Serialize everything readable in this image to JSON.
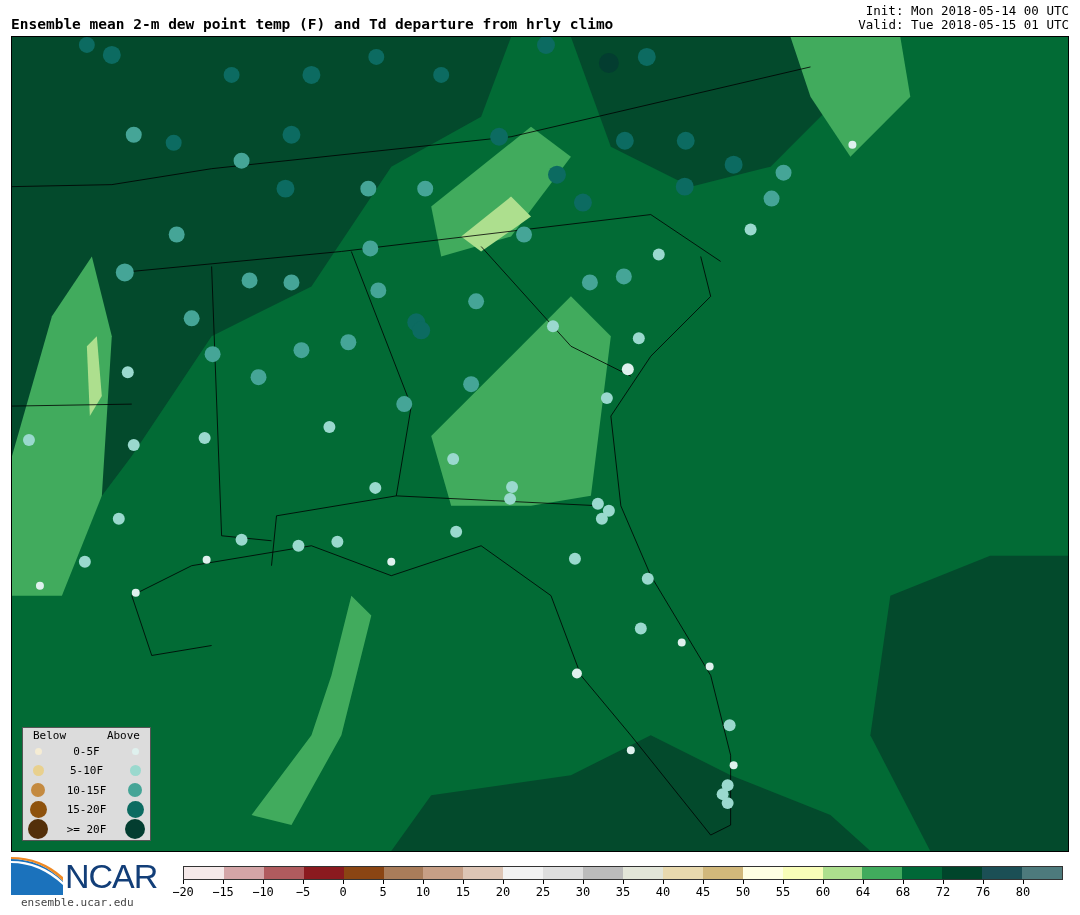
{
  "header": {
    "title": "Ensemble mean 2-m dew point temp (F) and Td departure from hrly climo",
    "init": "Init: Mon 2018-05-14 00 UTC",
    "valid": "Valid: Tue 2018-05-15 01 UTC"
  },
  "legend": {
    "below_label": "Below",
    "above_label": "Above",
    "rows": [
      {
        "label": "0-5F",
        "below": {
          "color": "#f5ecd4"
        },
        "above": {
          "color": "#dff1ee"
        }
      },
      {
        "label": "5-10F",
        "below": {
          "color": "#e8d08e"
        },
        "above": {
          "color": "#9ad9ce"
        }
      },
      {
        "label": "10-15F",
        "below": {
          "color": "#c48a40"
        },
        "above": {
          "color": "#45a597"
        }
      },
      {
        "label": "15-20F",
        "below": {
          "color": "#8e520d"
        },
        "above": {
          "color": "#0c6b61"
        }
      },
      {
        "label": ">= 20F",
        "below": {
          "color": "#532f09"
        },
        "above": {
          "color": "#033d30"
        }
      }
    ]
  },
  "footer": {
    "logo_text": "NCAR",
    "url": "ensemble.ucar.edu"
  },
  "colorbar": [
    {
      "label": "−20",
      "color": "#f5e9e9"
    },
    {
      "label": "−15",
      "color": "#d4a5a7"
    },
    {
      "label": "−10",
      "color": "#b05b5e"
    },
    {
      "label": "−5",
      "color": "#8b1a1f"
    },
    {
      "label": "0",
      "color": "#8b4513"
    },
    {
      "label": "5",
      "color": "#a97c5a"
    },
    {
      "label": "10",
      "color": "#c79f86"
    },
    {
      "label": "15",
      "color": "#ddc5b5"
    },
    {
      "label": "20",
      "color": "#f2f2f2"
    },
    {
      "label": "25",
      "color": "#dedede"
    },
    {
      "label": "30",
      "color": "#bbbbbb"
    },
    {
      "label": "35",
      "color": "#e2e5d8"
    },
    {
      "label": "40",
      "color": "#e8d9ae"
    },
    {
      "label": "45",
      "color": "#d1b87b"
    },
    {
      "label": "50",
      "color": "#ffffe3"
    },
    {
      "label": "55",
      "color": "#f8fdb8"
    },
    {
      "label": "60",
      "color": "#addf8e"
    },
    {
      "label": "64",
      "color": "#41ab5d"
    },
    {
      "label": "68",
      "color": "#006837"
    },
    {
      "label": "72",
      "color": "#00452b"
    },
    {
      "label": "76",
      "color": "#1b4f55"
    },
    {
      "label": "80",
      "color": "#4d7a7c"
    }
  ]
}
